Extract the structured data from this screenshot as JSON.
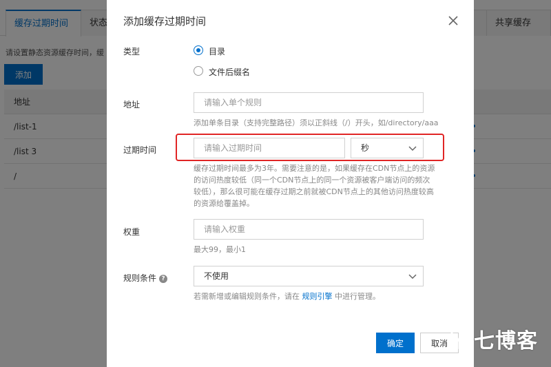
{
  "background": {
    "tabs": [
      "缓存过期时间",
      "状态",
      "共享缓存"
    ],
    "hint": "请设置静态资源缓存时间，缓",
    "add_label": "添加",
    "table": {
      "header": "地址",
      "rows": [
        "/list-1",
        "/list 3",
        "/"
      ]
    }
  },
  "modal": {
    "title": "添加缓存过期时间",
    "type": {
      "label": "类型",
      "options": [
        {
          "label": "目录",
          "checked": true
        },
        {
          "label": "文件后缀名",
          "checked": false
        }
      ]
    },
    "address": {
      "label": "地址",
      "placeholder": "请输入单个规则",
      "help": "添加单条目录（支持完整路径）须以正斜线（/）开头，如/directory/aaa"
    },
    "expire": {
      "label": "过期时间",
      "placeholder": "请输入过期时间",
      "unit": "秒",
      "help": [
        "缓存过期时间最多为3年。需要注意的是，如果缓存在CDN节点上的资源",
        "的访问热度较低（同一个CDN节点上的同一个资源被客户端访问的频次",
        "较低），那么很可能在缓存过期之前就被CDN节点上的其他访问热度较高",
        "的资源给覆盖掉。"
      ]
    },
    "weight": {
      "label": "权重",
      "placeholder": "请输入权重",
      "help": "最大99，最小1"
    },
    "rule": {
      "label": "规则条件",
      "value": "不使用",
      "help_prefix": "若需新增或编辑规则条件，请在 ",
      "help_link": "规则引擎",
      "help_suffix": " 中进行管理。"
    },
    "ok_label": "确定",
    "cancel_label": "取消"
  },
  "watermark": "七博客",
  "colors": {
    "accent": "#0070cc",
    "highlight": "#e02424"
  }
}
